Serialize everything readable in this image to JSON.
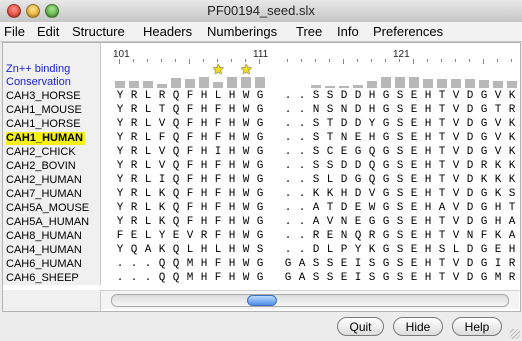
{
  "window": {
    "title": "PF00194_seed.slx"
  },
  "menu": [
    "File",
    "Edit",
    "Structure",
    "Headers",
    "Numberings",
    "Tree",
    "Info",
    "Preferences"
  ],
  "annotations": {
    "zn_binding": "Zn++ binding",
    "conservation": "Conservation"
  },
  "ruler": {
    "labels": [
      "101",
      "111",
      "121"
    ]
  },
  "sequences": [
    {
      "name": "CAH3_HORSE",
      "seq": "YRLRQFHLHWG..SSDDHGSEHTVDGVKYS"
    },
    {
      "name": "CAH1_MOUSE",
      "seq": "YRLTQFHFHWG..NSNDHGSEHTVDGTRYS"
    },
    {
      "name": "CAH1_HORSE",
      "seq": "YRLVQFHFHWG..STDDYGSEHTVDGVKYS"
    },
    {
      "name": "CAH1_HUMAN",
      "seq": "YRLFQFHFHWG..STNEHGSEHTVDGVKYS",
      "selected": true
    },
    {
      "name": "CAH2_CHICK",
      "seq": "YRLVQFHIHWG..SCEGQGSEHTVDGVKYD"
    },
    {
      "name": "CAH2_BOVIN",
      "seq": "YRLVQFHFHWG..SSDDQGSEHTVDRKKYA"
    },
    {
      "name": "CAH2_HUMAN",
      "seq": "YRLIQFHFHWG..SLDGQGSEHTVDKKKYA"
    },
    {
      "name": "CAH7_HUMAN",
      "seq": "YRLKQFHFHWG..KKHDVGSEHTVDGKSFP"
    },
    {
      "name": "CAH5A_MOUSE",
      "seq": "YRLKQFHFHWG..ATDEWGSEHAVDGHTYP"
    },
    {
      "name": "CAH5A_HUMAN",
      "seq": "YRLKQFHFHWG..AVNEGGSEHTVDGHAYP"
    },
    {
      "name": "CAH8_HUMAN",
      "seq": "FELYEVRFHWG..RENQRGSEHTVNFKAFP"
    },
    {
      "name": "CAH4_HUMAN",
      "seq": "YQAKQLHLHWS..DLPYKGSEHSLDGEHFA"
    },
    {
      "name": "CAH6_HUMAN",
      "seq": "...QQMHFHWGGASSEISGSEHTVDGIRHV"
    },
    {
      "name": "CAH6_SHEEP",
      "seq": "...QQMHFHWGGASSEISGSEHTVDGMRYV"
    }
  ],
  "conservation": [
    6,
    6,
    6,
    4,
    9,
    8,
    10,
    5,
    10,
    10,
    10,
    0,
    0,
    3,
    2,
    2,
    3,
    6,
    10,
    10,
    10,
    8,
    8,
    8,
    8,
    7,
    6,
    6,
    6,
    6
  ],
  "zn_binding_positions": [
    7,
    9
  ],
  "buttons": {
    "quit": "Quit",
    "hide": "Hide",
    "help": "Help"
  }
}
